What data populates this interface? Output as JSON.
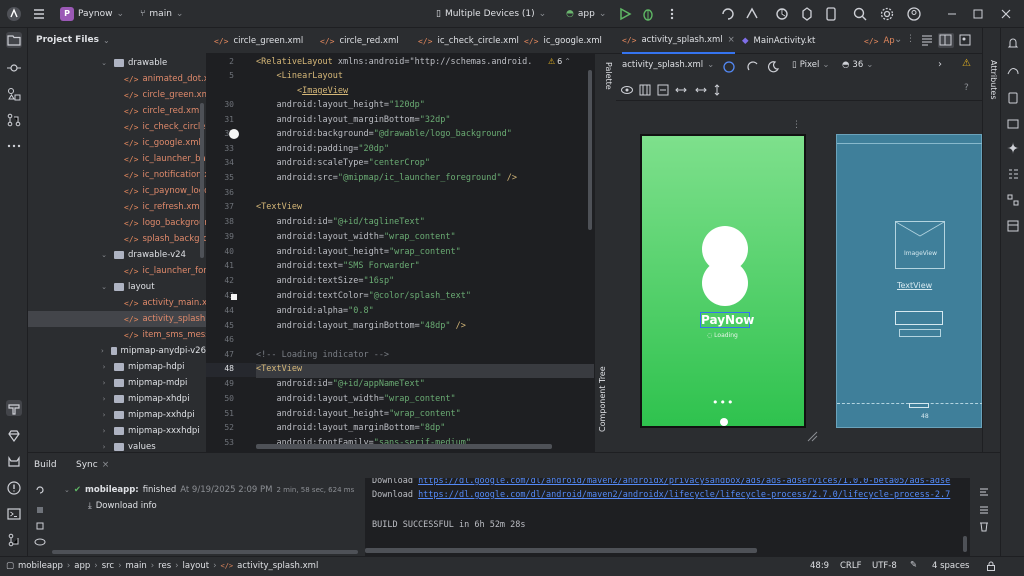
{
  "topbar": {
    "project_initial": "P",
    "project_name": "Paynow",
    "branch": "main",
    "devices": "Multiple Devices (1)",
    "run_config": "app"
  },
  "project_panel": {
    "title": "Project Files",
    "items": [
      {
        "label": "drawable",
        "kind": "folder",
        "open": true
      },
      {
        "label": "animated_dot.xml",
        "kind": "xml"
      },
      {
        "label": "circle_green.xml",
        "kind": "xml"
      },
      {
        "label": "circle_red.xml",
        "kind": "xml"
      },
      {
        "label": "ic_check_circle.xml",
        "kind": "xml"
      },
      {
        "label": "ic_google.xml",
        "kind": "xml"
      },
      {
        "label": "ic_launcher_background.xml",
        "kind": "xml"
      },
      {
        "label": "ic_notification.xml",
        "kind": "xml"
      },
      {
        "label": "ic_paynow_logo.xml",
        "kind": "xml"
      },
      {
        "label": "ic_refresh.xml",
        "kind": "xml"
      },
      {
        "label": "logo_background.xml",
        "kind": "xml"
      },
      {
        "label": "splash_background.xml",
        "kind": "xml"
      },
      {
        "label": "drawable-v24",
        "kind": "folder",
        "open": true
      },
      {
        "label": "ic_launcher_foreground.xml",
        "kind": "xml"
      },
      {
        "label": "layout",
        "kind": "folder",
        "open": true
      },
      {
        "label": "activity_main.xml",
        "kind": "xml"
      },
      {
        "label": "activity_splash.xml",
        "kind": "xml"
      },
      {
        "label": "item_sms_message.xml",
        "kind": "xml"
      },
      {
        "label": "mipmap-anydpi-v26",
        "kind": "folder",
        "open": false
      },
      {
        "label": "mipmap-hdpi",
        "kind": "folder",
        "open": false
      },
      {
        "label": "mipmap-mdpi",
        "kind": "folder",
        "open": false
      },
      {
        "label": "mipmap-xhdpi",
        "kind": "folder",
        "open": false
      },
      {
        "label": "mipmap-xxhdpi",
        "kind": "folder",
        "open": false
      },
      {
        "label": "mipmap-xxxhdpi",
        "kind": "folder",
        "open": false
      },
      {
        "label": "values",
        "kind": "folder",
        "open": false
      }
    ]
  },
  "editor": {
    "tabs": [
      "circle_green.xml",
      "circle_red.xml",
      "ic_check_circle.xml",
      "ic_google.xml",
      "activity_splash.xml",
      "MainActivity.kt",
      "Ap"
    ],
    "warnings_count": "6",
    "line_numbers": [
      "2",
      "5",
      "30",
      "31",
      "32",
      "33",
      "34",
      "35",
      "36",
      "37",
      "38",
      "39",
      "40",
      "41",
      "42",
      "43",
      "44",
      "45",
      "46",
      "47",
      "48",
      "49",
      "50",
      "51",
      "52",
      "53"
    ],
    "lines": [
      "<RelativeLayout xmlns:android=\"http://schemas.android.",
      "    <LinearLayout",
      "        <ImageView",
      "    android:layout_height=\"120dp\"",
      "    android:layout_marginBottom=\"32dp\"",
      "    android:background=\"@drawable/logo_background\"",
      "    android:padding=\"20dp\"",
      "    android:scaleType=\"centerCrop\"",
      "    android:src=\"@mipmap/ic_launcher_foreground\" />",
      "",
      "<TextView",
      "    android:id=\"@+id/taglineText\"",
      "    android:layout_width=\"wrap_content\"",
      "    android:layout_height=\"wrap_content\"",
      "    android:text=\"SMS Forwarder\"",
      "    android:textSize=\"16sp\"",
      "    android:textColor=\"@color/splash_text\"",
      "    android:alpha=\"0.8\"",
      "    android:layout_marginBottom=\"48dp\" />",
      "",
      "<!-- Loading indicator -->",
      "<TextView",
      "    android:id=\"@+id/appNameText\"",
      "    android:layout_width=\"wrap_content\"",
      "    android:layout_height=\"wrap_content\"",
      "    android:layout_marginBottom=\"8dp\"",
      "    android:fontFamily=\"sans-serif-medium\""
    ]
  },
  "design": {
    "file": "activity_splash.xml",
    "device": "Pixel",
    "api": "36",
    "palette_label": "Palette",
    "component_tree_label": "Component Tree",
    "attributes_label": "Attributes",
    "preview_app_name": "PayNow",
    "preview_loading": "Loading",
    "preview_dots": "•••",
    "blueprint_imageview": "ImageView",
    "blueprint_textview": "TextView",
    "blueprint_dim": "48",
    "colors": {
      "green_top": "#7ee08c",
      "green_bottom": "#2fc24e",
      "blueprint": "#3f7f9a"
    }
  },
  "build": {
    "tab_build": "Build",
    "tab_sync": "Sync",
    "task_name": "mobileapp:",
    "task_status": "finished",
    "task_time": "At 9/19/2025 2:09 PM",
    "task_duration": "2 min, 58 sec, 624 ms",
    "download_info": "Download info",
    "console_line1_prefix": "Download ",
    "console_line1_url": "https://dl.google.com/dl/android/maven2/androidx/privacysandbox/ads/ads-adservices/1.0.0-beta05/ads-adse",
    "console_line2_prefix": "Download ",
    "console_line2_url": "https://dl.google.com/dl/android/maven2/androidx/lifecycle/lifecycle-process/2.7.0/lifecycle-process-2.7",
    "console_result": "BUILD SUCCESSFUL in 6h 52m 28s"
  },
  "statusbar": {
    "breadcrumbs": [
      "mobileapp",
      "app",
      "src",
      "main",
      "res",
      "layout",
      "activity_splash.xml"
    ],
    "position": "48:9",
    "line_ending": "CRLF",
    "encoding": "UTF-8",
    "indent": "4 spaces"
  }
}
